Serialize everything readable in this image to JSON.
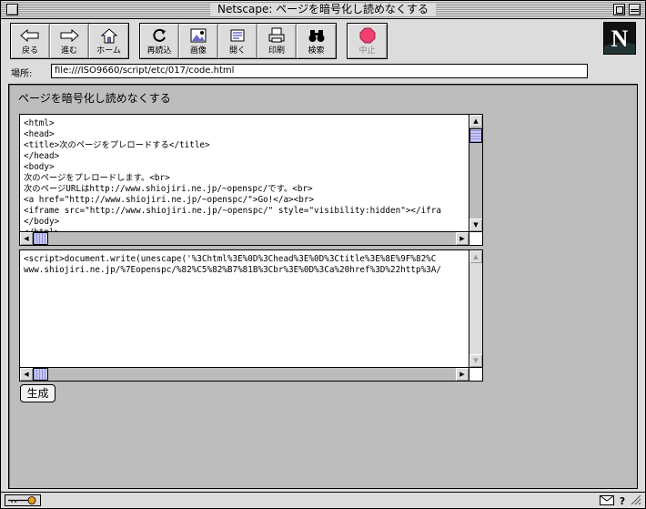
{
  "window": {
    "title": "Netscape: ページを暗号化し読めなくする"
  },
  "toolbar": {
    "buttons": [
      {
        "label": "戻る",
        "icon": "back-arrow-icon"
      },
      {
        "label": "進む",
        "icon": "forward-arrow-icon"
      },
      {
        "label": "ホーム",
        "icon": "home-icon"
      },
      {
        "label": "再読込",
        "icon": "reload-icon"
      },
      {
        "label": "画像",
        "icon": "images-icon"
      },
      {
        "label": "開く",
        "icon": "open-icon"
      },
      {
        "label": "印刷",
        "icon": "print-icon"
      },
      {
        "label": "検索",
        "icon": "find-binoculars-icon"
      },
      {
        "label": "中止",
        "icon": "stop-icon"
      }
    ],
    "logo_letter": "N"
  },
  "location": {
    "label": "場所:",
    "url": "file:///ISO9660/script/etc/017/code.html"
  },
  "page": {
    "heading": "ページを暗号化し読めなくする",
    "source_text": "<html>\n<head>\n<title>次のページをプレロードする</title>\n</head>\n<body>\n次のページをプレロードします。<br>\n次のページURLはhttp://www.shiojiri.ne.jp/~openspc/です。<br>\n<a href=\"http://www.shiojiri.ne.jp/~openspc/\">Go!</a><br>\n<iframe src=\"http://www.shiojiri.ne.jp/~openspc/\" style=\"visibility:hidden\"></ifra\n</body>\n</html>",
    "output_text": "<script>document.write(unescape('%3Chtml%3E%0D%3Chead%3E%0D%3Ctitle%3E%8E%9F%82%C\nwww.shiojiri.ne.jp/%7Eopenspc/%82%C5%82%B7%81B%3Cbr%3E%0D%3Ca%20href%3D%22http%3A/",
    "generate_button": "生成"
  },
  "colors": {
    "window_bg": "#dcdcdc",
    "content_bg": "#bdbdbd",
    "stop_red": "#f04070",
    "scroll_thumb": "#c8c8ff"
  }
}
